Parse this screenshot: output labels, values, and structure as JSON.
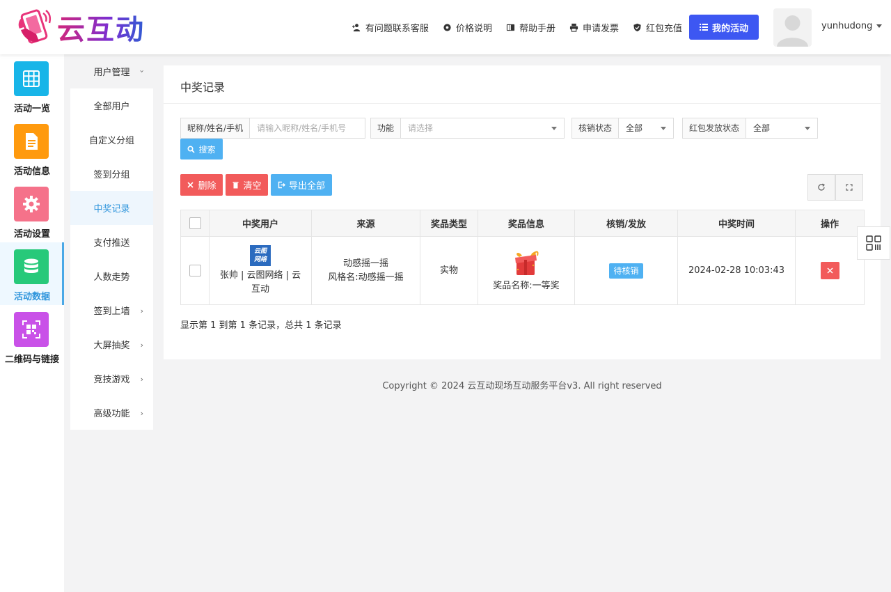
{
  "header": {
    "logo_text": "云互动",
    "nav": [
      {
        "label": "有问题联系客服",
        "icon": "user-plus-icon"
      },
      {
        "label": "价格说明",
        "icon": "gear-icon"
      },
      {
        "label": "帮助手册",
        "icon": "book-icon"
      },
      {
        "label": "申请发票",
        "icon": "printer-icon"
      },
      {
        "label": "红包充值",
        "icon": "shield-check-icon"
      }
    ],
    "my_activity_label": "我的活动",
    "username": "yunhudong"
  },
  "iconbar": {
    "items": [
      {
        "label": "活动一览",
        "icon": "grid-icon",
        "color": "#18b5e8"
      },
      {
        "label": "活动信息",
        "icon": "document-icon",
        "color": "#ff9a0e"
      },
      {
        "label": "活动设置",
        "icon": "gear-icon",
        "color": "#f5728a"
      },
      {
        "label": "活动数据",
        "icon": "database-icon",
        "color": "#27c97a",
        "active": true
      },
      {
        "label": "二维码与链接",
        "icon": "qrcode-icon",
        "color": "#c951e8"
      }
    ]
  },
  "submenu": {
    "items": [
      {
        "label": "用户管理",
        "chevron": true
      },
      {
        "label": "全部用户"
      },
      {
        "label": "自定义分组"
      },
      {
        "label": "签到分组"
      },
      {
        "label": "中奖记录",
        "active": true
      },
      {
        "label": "支付推送"
      },
      {
        "label": "人数走势"
      },
      {
        "label": "签到上墙",
        "chevron": true
      },
      {
        "label": "大屏抽奖",
        "chevron": true
      },
      {
        "label": "竞技游戏",
        "chevron": true
      },
      {
        "label": "高级功能",
        "chevron": true
      }
    ]
  },
  "card": {
    "title": "中奖记录",
    "filters": {
      "name_label": "昵称/姓名/手机",
      "name_placeholder": "请输入昵称/姓名/手机号",
      "function_label": "功能",
      "function_placeholder": "请选择",
      "verify_label": "核销状态",
      "verify_value": "全部",
      "redpack_label": "红包发放状态",
      "redpack_value": "全部"
    },
    "buttons": {
      "search": "搜索",
      "delete": "删除",
      "clear": "清空",
      "export": "导出全部"
    },
    "table": {
      "columns": [
        "中奖用户",
        "来源",
        "奖品类型",
        "奖品信息",
        "核销/发放",
        "中奖时间",
        "操作"
      ],
      "rows": [
        {
          "user_logo_line1": "云图",
          "user_logo_line2": "网络",
          "user": "张帅 | 云图网络 | 云互动",
          "source_line1": "动感摇一摇",
          "source_line2": "风格名:动感摇一摇",
          "prize_type": "实物",
          "prize_info": "奖品名称:一等奖",
          "status": "待核销",
          "time": "2024-02-28 10:03:43"
        }
      ]
    },
    "summary": "显示第 1 到第 1 条记录，总共 1 条记录"
  },
  "footer": {
    "copyright": "Copyright © 2024 云互动现场互动服务平台v3. All right reserved"
  }
}
